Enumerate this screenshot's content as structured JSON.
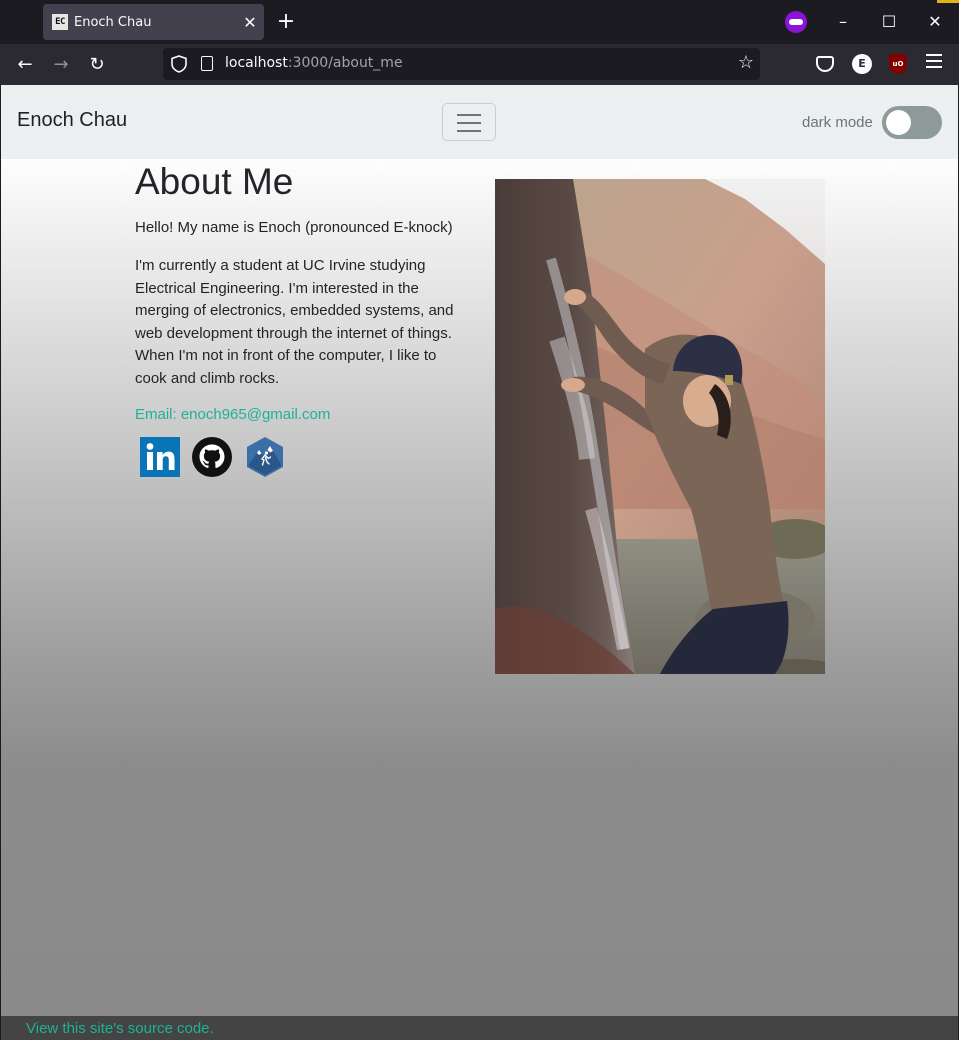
{
  "browser": {
    "tab": {
      "favicon_text": "EC",
      "title": "Enoch Chau",
      "close": "✕"
    },
    "new_tab": "+",
    "window_controls": {
      "minimize": "–",
      "maximize": "☐",
      "close": "✕"
    },
    "nav": {
      "back": "←",
      "forward": "→",
      "reload": "↻"
    },
    "url": {
      "host": "localhost",
      "path": ":3000/about_me"
    },
    "bookmark": "☆",
    "extensions": {
      "e_letter": "E",
      "ublock": "uO"
    },
    "icons": [
      "shield-icon",
      "page-icon",
      "star-icon",
      "pocket-icon",
      "menu-icon",
      "mask-icon"
    ]
  },
  "site": {
    "brand": "Enoch Chau",
    "dark_mode_label": "dark mode",
    "dark_mode_on": false
  },
  "about": {
    "heading": "About Me",
    "intro": "Hello! My name is Enoch (pronounced E-knock)",
    "bio": "I'm currently a student at UC Irvine studying Electrical Engineering. I'm interested in the merging of electronics, embedded systems, and web development through the internet of things. When I'm not in front of the computer, I like to cook and climb rocks.",
    "email": "Email: enoch965@gmail.com",
    "social": {
      "linkedin": "in",
      "github_icon": "github-icon",
      "mountain_project_icon": "mountain-project-icon"
    }
  },
  "footer": {
    "link": "View this site's source code."
  },
  "colors": {
    "accent": "#1fb198",
    "navbar": "#ebeff0",
    "footer": "#444444"
  }
}
